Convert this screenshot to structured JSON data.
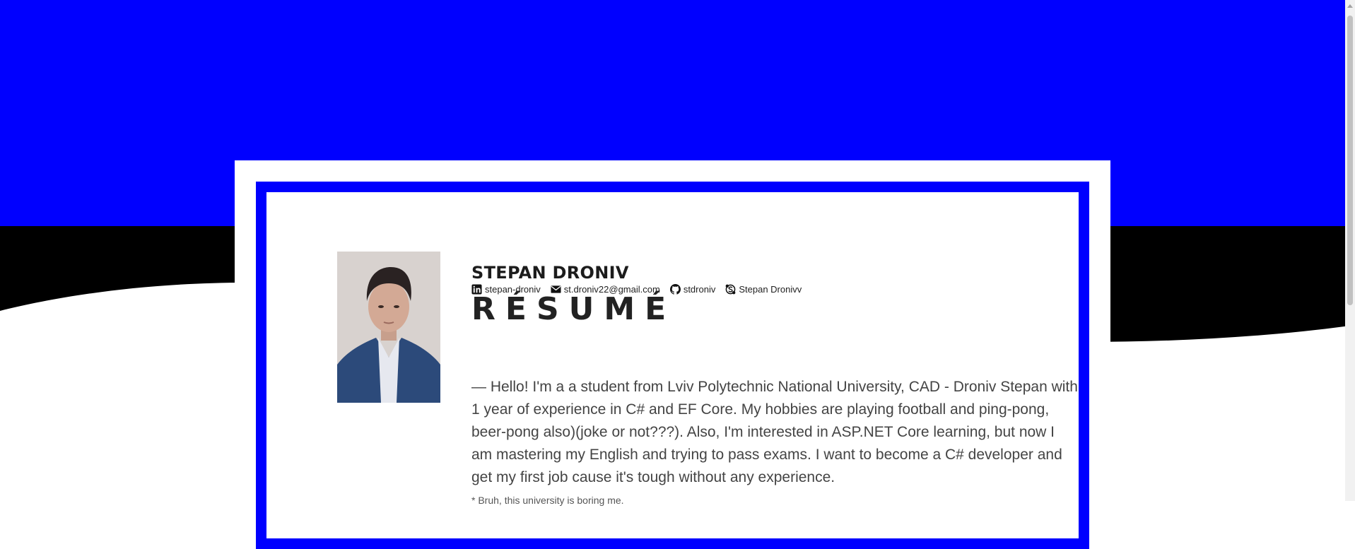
{
  "profile": {
    "name": "STEPAN DRONIV",
    "photo_alt": "",
    "contacts": {
      "linkedin": "stepan-droniv",
      "email": "st.droniv22@gmail.com",
      "github": "stdroniv",
      "skype": "Stepan Dronivv"
    }
  },
  "resume": {
    "title": "RÉSUMÉ",
    "bio": "— Hello! I'm a a student from Lviv Polytechnic National University, CAD - Droniv Stepan with 1 year of experience in C# and EF Core. My hobbies are playing football and ping-pong, beer-pong also)(joke or not???). Also, I'm interested in ASP.NET Core learning, but now I am mastering my English and trying to pass exams. I want to become a C# developer and get my first job cause it's tough without any experience.",
    "note": "* Bruh, this university is boring me."
  },
  "colors": {
    "accent": "#0000ff",
    "wave": "#000000",
    "background": "#ffffff"
  }
}
